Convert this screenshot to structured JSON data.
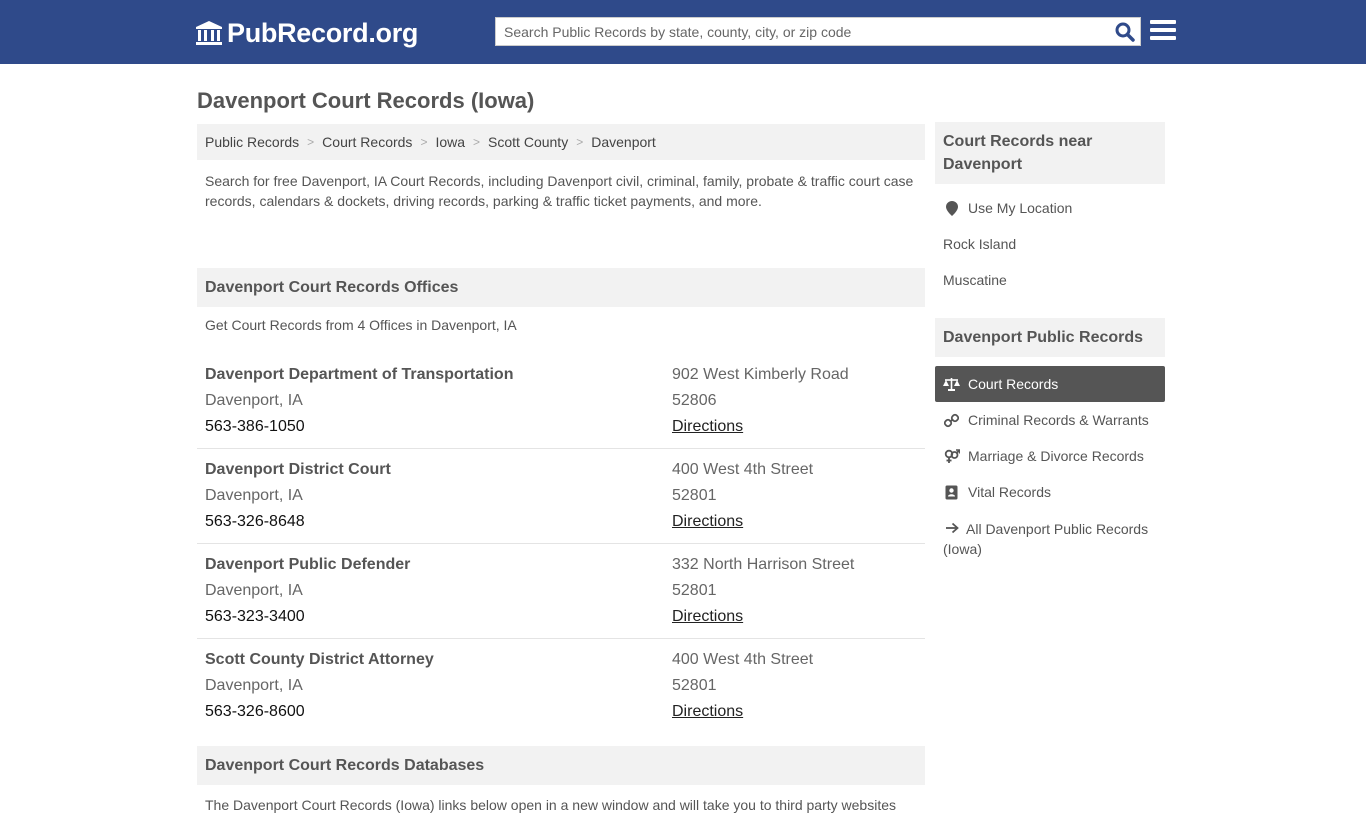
{
  "header": {
    "logo_text": "PubRecord.org",
    "search_placeholder": "Search Public Records by state, county, city, or zip code",
    "search_value": ""
  },
  "page": {
    "title": "Davenport Court Records (Iowa)"
  },
  "breadcrumb": {
    "items": [
      "Public Records",
      "Court Records",
      "Iowa",
      "Scott County",
      "Davenport"
    ]
  },
  "intro": "Search for free Davenport, IA Court Records, including Davenport civil, criminal, family, probate & traffic court case records, calendars & dockets, driving records, parking & traffic ticket payments, and more.",
  "offices_section": {
    "title": "Davenport Court Records Offices",
    "subtitle": "Get Court Records from 4 Offices in Davenport, IA",
    "offices": [
      {
        "name": "Davenport Department of Transportation",
        "city": "Davenport, IA",
        "phone": "563-386-1050",
        "street": "902 West Kimberly Road",
        "zip": "52806",
        "directions": "Directions"
      },
      {
        "name": "Davenport District Court",
        "city": "Davenport, IA",
        "phone": "563-326-8648",
        "street": "400 West 4th Street",
        "zip": "52801",
        "directions": "Directions"
      },
      {
        "name": "Davenport Public Defender",
        "city": "Davenport, IA",
        "phone": "563-323-3400",
        "street": "332 North Harrison Street",
        "zip": "52801",
        "directions": "Directions"
      },
      {
        "name": "Scott County District Attorney",
        "city": "Davenport, IA",
        "phone": "563-326-8600",
        "street": "400 West 4th Street",
        "zip": "52801",
        "directions": "Directions"
      }
    ]
  },
  "databases_section": {
    "title": "Davenport Court Records Databases",
    "text": "The Davenport Court Records (Iowa) links below open in a new window and will take you to third party websites"
  },
  "sidebar": {
    "nearby": {
      "title": "Court Records near Davenport",
      "items": [
        {
          "label": "Use My Location",
          "icon": "map-marker-icon"
        },
        {
          "label": "Rock Island"
        },
        {
          "label": "Muscatine"
        }
      ]
    },
    "public_records": {
      "title": "Davenport Public Records",
      "items": [
        {
          "label": "Court Records",
          "icon": "scales-icon",
          "active": true
        },
        {
          "label": "Criminal Records & Warrants",
          "icon": "link-icon"
        },
        {
          "label": "Marriage & Divorce Records",
          "icon": "gender-icon"
        },
        {
          "label": "Vital Records",
          "icon": "contact-book-icon"
        },
        {
          "label": "All Davenport Public Records (Iowa)",
          "icon": "arrow-right-icon"
        }
      ]
    }
  },
  "colors": {
    "header_bg": "#2f4a8a",
    "search_icon": "#2f4a8a",
    "active_item_bg": "#555555",
    "panel_bg": "#f2f2f2"
  }
}
